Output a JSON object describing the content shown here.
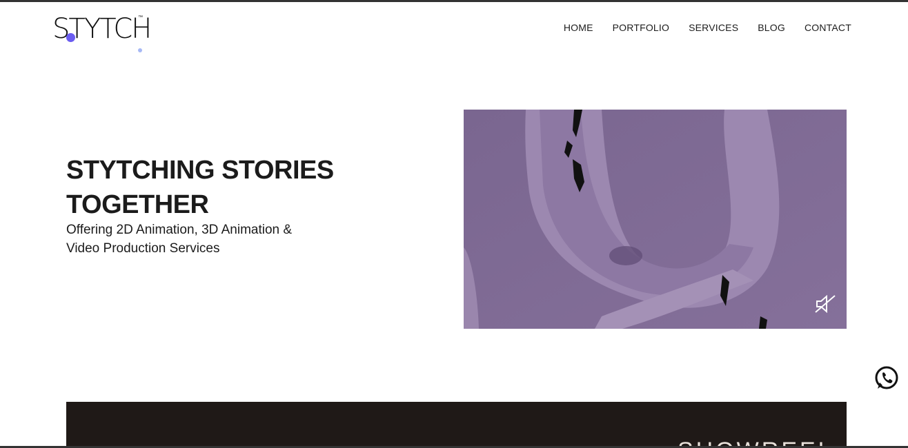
{
  "brand": {
    "logo_text": "STYTCH",
    "tm": "™"
  },
  "nav": {
    "items": [
      {
        "label": "HOME"
      },
      {
        "label": "PORTFOLIO"
      },
      {
        "label": "SERVICES"
      },
      {
        "label": "BLOG"
      },
      {
        "label": "CONTACT"
      }
    ]
  },
  "hero": {
    "title": "STYTCHING STORIES TOGETHER",
    "subtitle": "Offering 2D Animation, 3D Animation & Video Production Services"
  },
  "video": {
    "mute_icon": "speaker-muted-icon"
  },
  "floating": {
    "whatsapp_icon": "whatsapp-icon"
  },
  "showreel": {
    "label": "SHOWREEL"
  },
  "colors": {
    "accent": "#6a5cf0",
    "video_bg": "#7f6a93",
    "showreel_bg": "#1f1917"
  }
}
